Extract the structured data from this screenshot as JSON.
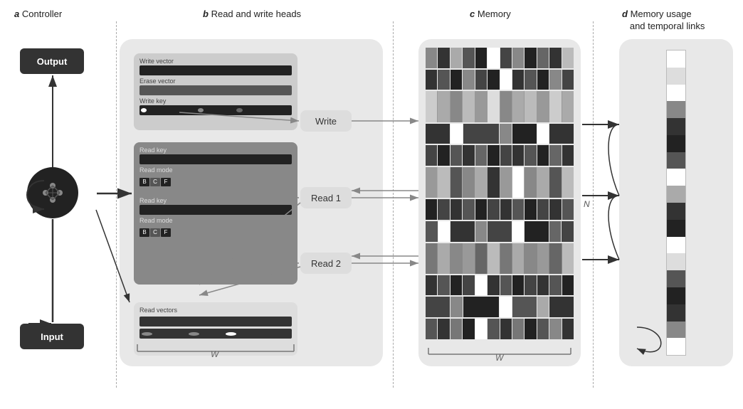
{
  "sections": {
    "a": {
      "label": "a",
      "title": "Controller"
    },
    "b": {
      "label": "b",
      "title": "Read and write heads"
    },
    "c": {
      "label": "c",
      "title": "Memory"
    },
    "d": {
      "label": "d",
      "title": "Memory usage\nand temporal links"
    }
  },
  "controller": {
    "output_label": "Output",
    "input_label": "Input"
  },
  "write_head": {
    "write_vector_label": "Write vector",
    "erase_vector_label": "Erase vector",
    "write_key_label": "Write key"
  },
  "read_head1": {
    "read_key_label": "Read key",
    "read_mode_label": "Read mode",
    "bcf": [
      "B",
      "C",
      "F"
    ]
  },
  "read_head2": {
    "read_key_label": "Read key",
    "read_mode_label": "Read mode",
    "bcf": [
      "B",
      "C",
      "F"
    ]
  },
  "read_vectors": {
    "label": "Read vectors"
  },
  "buttons": {
    "write": "Write",
    "read1": "Read 1",
    "read2": "Read 2"
  },
  "labels": {
    "W": "W",
    "N": "N"
  }
}
